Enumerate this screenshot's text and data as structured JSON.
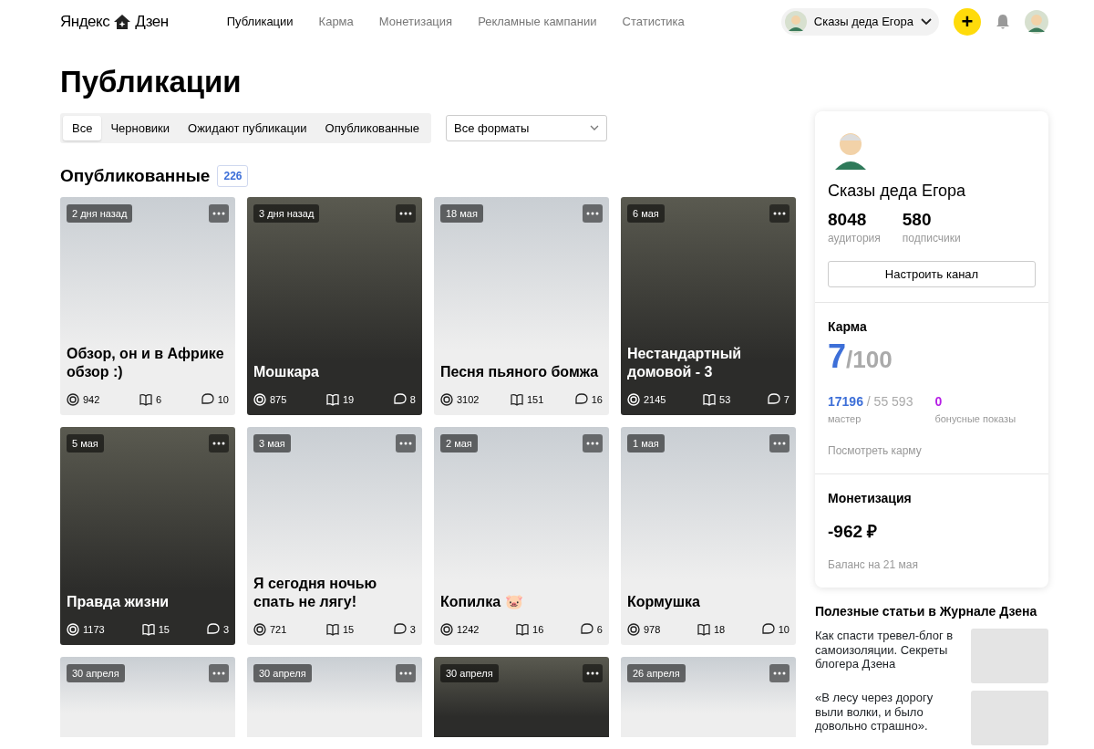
{
  "header": {
    "logo_left": "Яндекс",
    "logo_right": "Дзен",
    "nav": [
      {
        "label": "Публикации",
        "selected": true
      },
      {
        "label": "Карма",
        "selected": false
      },
      {
        "label": "Монетизация",
        "selected": false
      },
      {
        "label": "Рекламные кампании",
        "selected": false
      },
      {
        "label": "Статистика",
        "selected": false
      }
    ],
    "channel": "Сказы деда Егора",
    "add": "+"
  },
  "page_title": "Публикации",
  "filters": [
    {
      "label": "Все",
      "selected": true
    },
    {
      "label": "Черновики",
      "selected": false
    },
    {
      "label": "Ожидают публикации",
      "selected": false
    },
    {
      "label": "Опубликованные",
      "selected": false
    }
  ],
  "format_select": "Все форматы",
  "section": {
    "title": "Опубликованные",
    "count": "226"
  },
  "cards": [
    {
      "date": "2 дня назад",
      "title": "Обзор, он и в Африке обзор :)",
      "dark": false,
      "views": "942",
      "reads": "6",
      "comments": "10"
    },
    {
      "date": "3 дня назад",
      "title": "Мошкара",
      "dark": true,
      "views": "875",
      "reads": "19",
      "comments": "8"
    },
    {
      "date": "18 мая",
      "title": "Песня пьяного бомжа",
      "dark": false,
      "views": "3102",
      "reads": "151",
      "comments": "16"
    },
    {
      "date": "6 мая",
      "title": "Нестандартный домовой - 3",
      "dark": true,
      "views": "2145",
      "reads": "53",
      "comments": "7"
    },
    {
      "date": "5 мая",
      "title": "Правда жизни",
      "dark": true,
      "views": "1173",
      "reads": "15",
      "comments": "3"
    },
    {
      "date": "3 мая",
      "title": "Я сегодня ночью спать не лягу!",
      "dark": false,
      "views": "721",
      "reads": "15",
      "comments": "3"
    },
    {
      "date": "2 мая",
      "title": "Копилка 🐷",
      "dark": false,
      "views": "1242",
      "reads": "16",
      "comments": "6"
    },
    {
      "date": "1 мая",
      "title": "Кормушка",
      "dark": false,
      "views": "978",
      "reads": "18",
      "comments": "10"
    },
    {
      "date": "30 апреля",
      "dark": false
    },
    {
      "date": "30 апреля",
      "dark": false
    },
    {
      "date": "30 апреля",
      "dark": true
    },
    {
      "date": "26 апреля",
      "dark": false
    }
  ],
  "channel_card": {
    "name": "Сказы деда Егора",
    "stats": [
      {
        "value": "8048",
        "label": "аудитория"
      },
      {
        "value": "580",
        "label": "подписчики"
      }
    ],
    "button": "Настроить канал",
    "karma": {
      "title": "Карма",
      "value": "7",
      "max": "/100",
      "score": "17196",
      "score_max": " / 55 593",
      "score_label": "мастер",
      "bonus": "0",
      "bonus_label": "бонусные показы",
      "link": "Посмотреть карму"
    },
    "money": {
      "title": "Монетизация",
      "value": "-962 ₽",
      "note": "Баланс на 21 мая"
    }
  },
  "articles": {
    "title": "Полезные статьи в Журнале Дзена",
    "items": [
      {
        "text": "Как спасти тревел-блог в самоизоляции. Секреты блогера Дзена"
      },
      {
        "text": "«В лесу через дорогу выли волки, и было довольно страшно»."
      }
    ]
  }
}
